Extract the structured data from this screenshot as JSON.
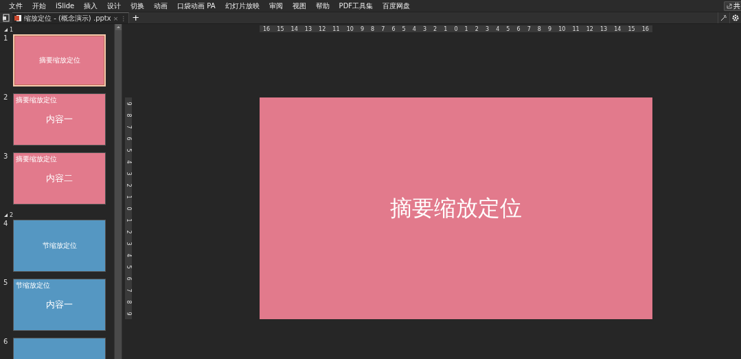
{
  "menu": [
    "文件",
    "开始",
    "iSlide",
    "插入",
    "设计",
    "切换",
    "动画",
    "口袋动画 PA",
    "幻灯片放映",
    "审阅",
    "视图",
    "帮助",
    "PDF工具集",
    "百度网盘"
  ],
  "share": {
    "label": "共"
  },
  "tabs": [
    {
      "label": "缩放定位 - (概念演示) .pptx",
      "close": "×",
      "more": "⋮",
      "selected": true
    }
  ],
  "new_tab": "+",
  "ruler_horizontal": [
    "16",
    "15",
    "14",
    "13",
    "12",
    "11",
    "10",
    "9",
    "8",
    "7",
    "6",
    "5",
    "4",
    "3",
    "2",
    "1",
    "0",
    "1",
    "2",
    "3",
    "4",
    "5",
    "6",
    "7",
    "8",
    "9",
    "10",
    "11",
    "12",
    "13",
    "14",
    "15",
    "16"
  ],
  "ruler_vertical": [
    "9",
    "8",
    "7",
    "6",
    "5",
    "4",
    "3",
    "2",
    "1",
    "0",
    "1",
    "2",
    "3",
    "4",
    "5",
    "6",
    "7",
    "8",
    "9"
  ],
  "sections": [
    {
      "label": "1",
      "expanded": true,
      "children": [
        {
          "number": "1",
          "kind": "title",
          "title": "摘要缩放定位",
          "color": "#e27a8c",
          "selected": true
        },
        {
          "number": "2",
          "kind": "content",
          "corner": "摘要缩放定位",
          "title": "内容一",
          "color": "#e27a8c",
          "selected": false
        },
        {
          "number": "3",
          "kind": "content",
          "corner": "摘要缩放定位",
          "title": "内容二",
          "color": "#e27a8c",
          "selected": false
        }
      ]
    },
    {
      "label": "2",
      "expanded": true,
      "children": [
        {
          "number": "4",
          "kind": "title",
          "title": "节缩放定位",
          "color": "#5597c2",
          "selected": false
        },
        {
          "number": "5",
          "kind": "content",
          "corner": "节缩放定位",
          "title": "内容一",
          "color": "#5597c2",
          "selected": false
        },
        {
          "number": "6",
          "kind": "content",
          "color": "#5597c2",
          "selected": false
        }
      ]
    }
  ],
  "slide": {
    "title": "摘要缩放定位",
    "color": "#e27a8c"
  }
}
